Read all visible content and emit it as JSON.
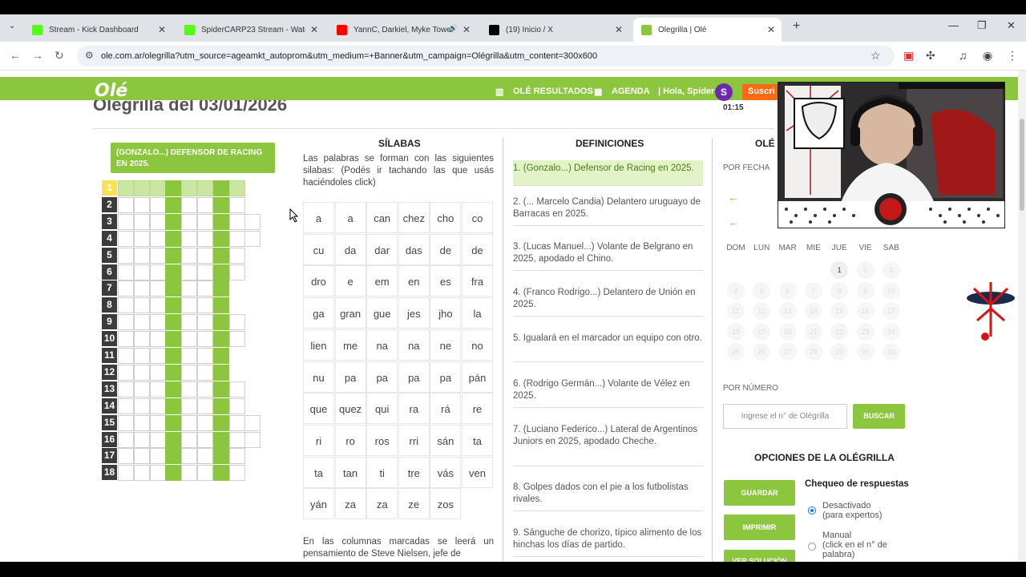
{
  "browser": {
    "tabs": [
      {
        "title": "Stream - Kick Dashboard",
        "icon": "kick-icon",
        "color": "#53fc18"
      },
      {
        "title": "SpiderCARP23 Stream - Watch",
        "icon": "kick-icon",
        "color": "#53fc18"
      },
      {
        "title": "YannC, Darkiel, Myke Tower",
        "icon": "youtube-icon",
        "color": "#ff0000"
      },
      {
        "title": "(19) Inicio / X",
        "icon": "x-icon",
        "color": "#000000"
      },
      {
        "title": "Olegrilla | Olé",
        "icon": "ole-icon",
        "color": "#8cc63e"
      }
    ],
    "url": "ole.com.ar/olegrilla?utm_source=ageamkt_autoprom&utm_medium=+Banner&utm_campaign=Olégrilla&utm_content=300x600"
  },
  "site": {
    "logo": "Olé",
    "nav": {
      "resultados": "OLÉ RESULTADOS",
      "agenda": "AGENDA",
      "greeting": "| Hola, Spider",
      "avatar": "S",
      "subscribe": "Suscri"
    },
    "page_title": "Olegrilla del 03/01/2026",
    "timer": "01:15"
  },
  "crossword": {
    "clue": "(GONZALO...) DEFENSOR DE RACING EN 2025.",
    "rows": [
      {
        "n": "1",
        "len": 8
      },
      {
        "n": "2",
        "len": 8
      },
      {
        "n": "3",
        "len": 9
      },
      {
        "n": "4",
        "len": 9
      },
      {
        "n": "5",
        "len": 8
      },
      {
        "n": "6",
        "len": 8
      },
      {
        "n": "7",
        "len": 7
      },
      {
        "n": "8",
        "len": 7
      },
      {
        "n": "9",
        "len": 8
      },
      {
        "n": "10",
        "len": 8
      },
      {
        "n": "11",
        "len": 7
      },
      {
        "n": "12",
        "len": 7
      },
      {
        "n": "13",
        "len": 8
      },
      {
        "n": "14",
        "len": 8
      },
      {
        "n": "15",
        "len": 9
      },
      {
        "n": "16",
        "len": 9
      },
      {
        "n": "17",
        "len": 8
      },
      {
        "n": "18",
        "len": 8
      }
    ],
    "selected_row": "1",
    "marked_columns": [
      3,
      6
    ]
  },
  "silabas": {
    "title": "SÍLABAS",
    "intro": "Las palabras se forman con las siguientes silabas: (Podés ir tachando las que usás haciéndoles click)",
    "grid": [
      [
        "a",
        "a",
        "can",
        "chez",
        "cho",
        "co"
      ],
      [
        "cu",
        "da",
        "dar",
        "das",
        "de",
        "de"
      ],
      [
        "dro",
        "e",
        "em",
        "en",
        "es",
        "fra"
      ],
      [
        "ga",
        "gran",
        "gue",
        "jes",
        "jho",
        "la"
      ],
      [
        "lien",
        "me",
        "na",
        "na",
        "ne",
        "no"
      ],
      [
        "nu",
        "pa",
        "pa",
        "pa",
        "pa",
        "pán"
      ],
      [
        "que",
        "quez",
        "qui",
        "ra",
        "rá",
        "re"
      ],
      [
        "ri",
        "ro",
        "ros",
        "rri",
        "sán",
        "ta"
      ],
      [
        "ta",
        "tan",
        "ti",
        "tre",
        "vás",
        "ven"
      ],
      [
        "yán",
        "za",
        "za",
        "ze",
        "zos",
        ""
      ]
    ],
    "footer": "En las columnas marcadas se leerá un pensamiento de Steve Nielsen, jefe de"
  },
  "definiciones": {
    "title": "DEFINICIONES",
    "items": [
      "1. (Gonzalo...) Defensor de Racing en 2025.",
      "2. (... Marcelo Candia) Delantero uruguayo de Barracas en 2025.",
      "3. (Lucas Manuel...) Volante de Belgrano en 2025, apodado el Chino.",
      "4. (Franco Rodrigo...) Delantero de Unión en 2025.",
      "5. Igualará en el marcador un equipo con otro.",
      "6. (Rodrigo Germán...) Volante de Vélez en 2025.",
      "7. (Luciano Federico...) Lateral de Argentinos Juniors en 2025, apodado Cheche.",
      "8. Golpes dados con el pie a los futbolistas rivales.",
      "9. Sánguche de chorizo, típico alimento de los hinchas los días de partido."
    ]
  },
  "sidebar": {
    "title": "OLÉ",
    "por_fecha": "POR FECHA",
    "days_of_week": [
      "DOM",
      "LUN",
      "MAR",
      "MIE",
      "JUE",
      "VIE",
      "SAB"
    ],
    "calendar": [
      [
        "",
        "",
        "",
        "",
        "1",
        "2",
        "3"
      ],
      [
        "4",
        "5",
        "6",
        "7",
        "8",
        "9",
        "10"
      ],
      [
        "11",
        "12",
        "13",
        "14",
        "15",
        "16",
        "17"
      ],
      [
        "18",
        "19",
        "20",
        "21",
        "22",
        "23",
        "24"
      ],
      [
        "25",
        "26",
        "27",
        "28",
        "29",
        "30",
        "31"
      ]
    ],
    "por_numero": "POR NÚMERO",
    "number_placeholder": "Ingrese el n° de Olégrilla",
    "buscar": "BUSCAR",
    "opciones_title": "OPCIONES DE LA OLÉGRILLA",
    "guardar": "GUARDAR",
    "imprimir": "IMPRIMIR",
    "ver_solucion": "VER SOLUCIÓN",
    "chequeo_title": "Chequeo de respuestas",
    "opt_desactivado": "Desactivado",
    "opt_desactivado_sub": "(para expertos)",
    "opt_manual": "Manual",
    "opt_manual_sub": "(click en el n° de palabra)"
  }
}
